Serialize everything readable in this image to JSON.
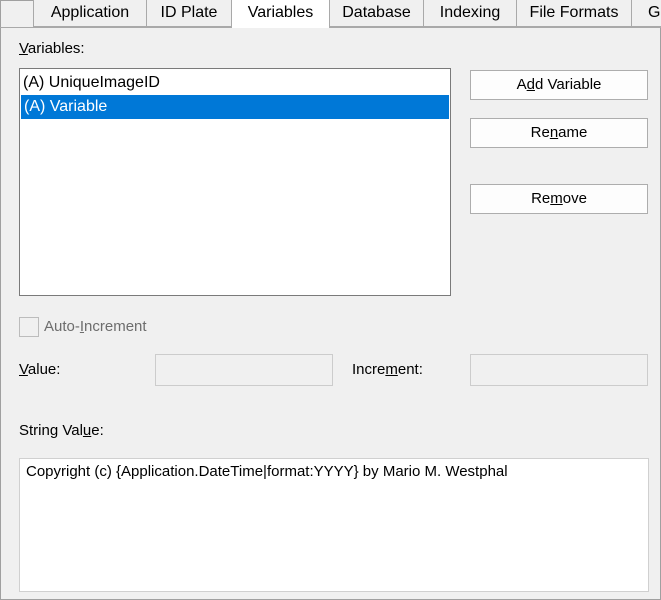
{
  "tabs": [
    {
      "label": "Application",
      "active": false
    },
    {
      "label": "ID Plate",
      "active": false
    },
    {
      "label": "Variables",
      "active": true
    },
    {
      "label": "Database",
      "active": false
    },
    {
      "label": "Indexing",
      "active": false
    },
    {
      "label": "File Formats",
      "active": false
    },
    {
      "label": "G",
      "active": false
    }
  ],
  "variables": {
    "label_pre": "",
    "label_key": "V",
    "label_post": "ariables:",
    "items": [
      {
        "text": "(A) UniqueImageID",
        "selected": false
      },
      {
        "text": "(A) Variable",
        "selected": true
      }
    ]
  },
  "buttons": {
    "add": {
      "pre": "A",
      "key": "d",
      "post": "d Variable"
    },
    "rename": {
      "pre": "Re",
      "key": "n",
      "post": "ame"
    },
    "remove": {
      "pre": "Re",
      "key": "m",
      "post": "ove"
    }
  },
  "auto_increment": {
    "pre": "Auto-",
    "key": "I",
    "post": "ncrement",
    "checked": false,
    "enabled": false
  },
  "value": {
    "pre": "",
    "key": "V",
    "post": "alue:",
    "current": ""
  },
  "increment": {
    "pre": "Incre",
    "key": "m",
    "post": "ent:",
    "current": ""
  },
  "string_value": {
    "pre": "String Val",
    "key": "u",
    "post": "e:",
    "text": "Copyright (c) {Application.DateTime|format:YYYY} by Mario M. Westphal"
  },
  "colors": {
    "selection": "#0078d7",
    "background": "#f0f0f0"
  }
}
